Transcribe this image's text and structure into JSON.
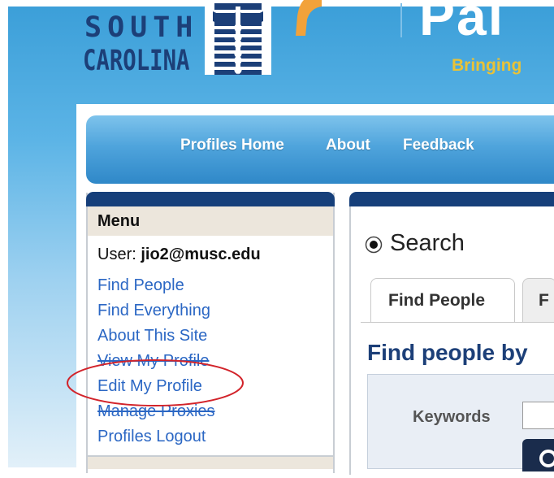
{
  "header": {
    "logo_line1": "SOUTH",
    "logo_line2": "CAROLINA",
    "brand_word": "Pal",
    "tagline": "Bringing"
  },
  "nav": {
    "items": [
      {
        "label": "Profiles Home"
      },
      {
        "label": "About"
      },
      {
        "label": "Feedback"
      }
    ]
  },
  "menu": {
    "title": "Menu",
    "user_prefix": "User: ",
    "user_email": "jio2@musc.edu",
    "links": [
      {
        "label": "Find People"
      },
      {
        "label": "Find Everything"
      },
      {
        "label": "About This Site"
      },
      {
        "label": "View My Profile"
      },
      {
        "label": "Edit My Profile"
      },
      {
        "label": "Manage Proxies"
      },
      {
        "label": "Profiles Logout"
      }
    ]
  },
  "search": {
    "heading": "Search",
    "tabs": [
      {
        "label": "Find People"
      },
      {
        "label": "F"
      }
    ],
    "section_heading": "Find people by",
    "keywords_label": "Keywords",
    "keywords_value": ""
  },
  "colors": {
    "brand_navy": "#1c3f78",
    "link_blue": "#2b67c4",
    "nav_blue": "#4fa4dc",
    "tagline_gold": "#e8c238",
    "highlight_red": "#d2232a"
  }
}
